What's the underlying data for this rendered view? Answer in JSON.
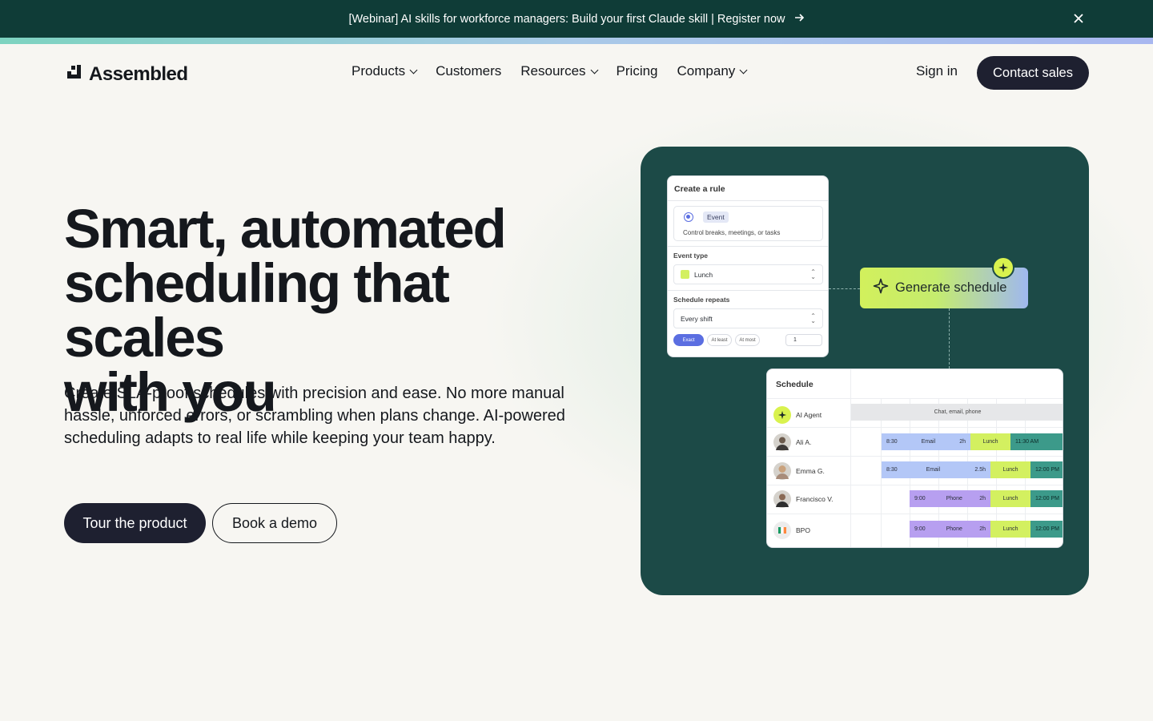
{
  "banner": {
    "text": "[Webinar] AI skills for workforce managers: Build your first Claude skill | Register now",
    "arrow_icon": "arrow-right-icon",
    "close_icon": "close-icon"
  },
  "header": {
    "logo_text": "Assembled",
    "nav": [
      {
        "label": "Products",
        "has_dropdown": true
      },
      {
        "label": "Customers",
        "has_dropdown": false
      },
      {
        "label": "Resources",
        "has_dropdown": true
      },
      {
        "label": "Pricing",
        "has_dropdown": false
      },
      {
        "label": "Company",
        "has_dropdown": true
      }
    ],
    "sign_in": "Sign in",
    "contact_sales": "Contact sales"
  },
  "hero": {
    "title_line1": "Smart, automated",
    "title_line2": "scheduling that scales",
    "title_line3": "with you",
    "subtitle": "Create SLA-proof schedules with precision and ease. No more manual hassle, unforced errors, or scrambling when plans change. AI-powered scheduling adapts to real life while keeping your team happy.",
    "primary_cta": "Tour the product",
    "secondary_cta": "Book a demo"
  },
  "product_card": {
    "rule": {
      "title": "Create a rule",
      "event_chip": "Event",
      "event_desc": "Control breaks, meetings, or tasks",
      "event_type_label": "Event type",
      "event_type_value": "Lunch",
      "repeats_label": "Schedule repeats",
      "repeats_value": "Every shift",
      "modes": [
        "Exact",
        "At least",
        "At most"
      ],
      "count": "1"
    },
    "generate_label": "Generate schedule",
    "schedule": {
      "title": "Schedule",
      "rows": [
        {
          "name": "AI Agent",
          "avatar": "sparkle-icon"
        },
        {
          "name": "Ali A.",
          "avatar": "avatar"
        },
        {
          "name": "Emma G.",
          "avatar": "avatar"
        },
        {
          "name": "Francisco V.",
          "avatar": "avatar"
        },
        {
          "name": "BPO",
          "avatar": "flag-icon"
        }
      ],
      "chat_block": "Chat, email, phone",
      "ali": {
        "start": "8:30",
        "task": "Email",
        "dur": "2h",
        "lunch": "Lunch",
        "next": "11:30 AM"
      },
      "emma": {
        "start": "8:30",
        "task": "Email",
        "dur": "2.5h",
        "lunch": "Lunch",
        "next": "12:00 PM"
      },
      "francisco": {
        "start": "9:00",
        "task": "Phone",
        "dur": "2h",
        "lunch": "Lunch",
        "next": "12:00 PM"
      },
      "bpo": {
        "start": "9:00",
        "task": "Phone",
        "dur": "2h",
        "lunch": "Lunch",
        "next": "12:00 PM"
      }
    }
  },
  "colors": {
    "banner_bg": "#0f3c37",
    "card_bg": "#1c4a47",
    "dark_button": "#1e2030",
    "lime": "#d3f060",
    "email_blue": "#b3c7f7",
    "phone_purple": "#b79ff0",
    "teal": "#3c9a8a"
  }
}
